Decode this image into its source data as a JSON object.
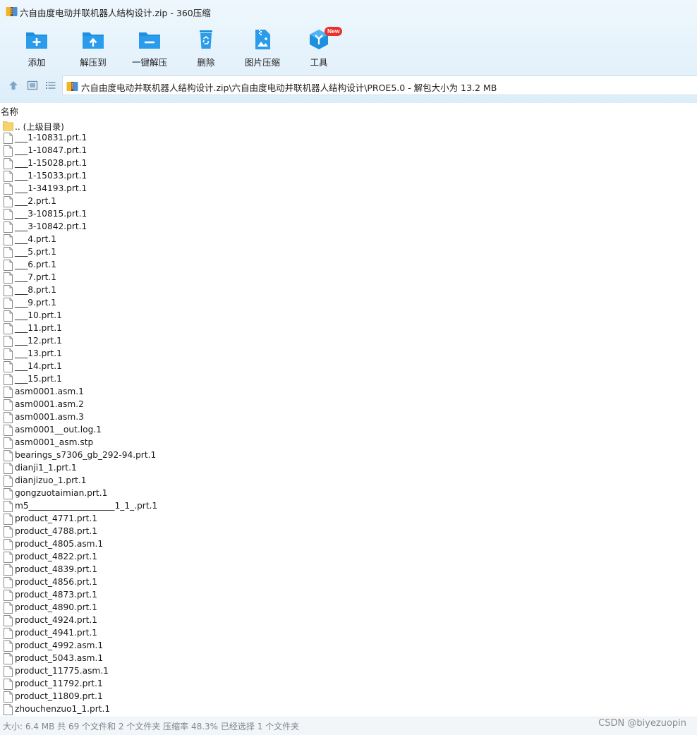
{
  "window": {
    "title": "六自由度电动并联机器人结构设计.zip - 360压缩"
  },
  "toolbar": {
    "add_label": "添加",
    "extract_to_label": "解压到",
    "one_click_extract_label": "一键解压",
    "delete_label": "删除",
    "image_compress_label": "图片压缩",
    "tools_label": "工具",
    "tools_badge": "New"
  },
  "address": {
    "path": "六自由度电动并联机器人结构设计.zip\\六自由度电动并联机器人结构设计\\PROE5.0 - 解包大小为 13.2 MB"
  },
  "list": {
    "column_name": "名称",
    "parent_label": ".. (上级目录)",
    "files": [
      "___1-10831.prt.1",
      "___1-10847.prt.1",
      "___1-15028.prt.1",
      "___1-15033.prt.1",
      "___1-34193.prt.1",
      "___2.prt.1",
      "___3-10815.prt.1",
      "___3-10842.prt.1",
      "___4.prt.1",
      "___5.prt.1",
      "___6.prt.1",
      "___7.prt.1",
      "___8.prt.1",
      "___9.prt.1",
      "___10.prt.1",
      "___11.prt.1",
      "___12.prt.1",
      "___13.prt.1",
      "___14.prt.1",
      "___15.prt.1",
      "asm0001.asm.1",
      "asm0001.asm.2",
      "asm0001.asm.3",
      "asm0001__out.log.1",
      "asm0001_asm.stp",
      "bearings_s7306_gb_292-94.prt.1",
      "dianji1_1.prt.1",
      "dianjizuo_1.prt.1",
      "gongzuotaimian.prt.1",
      "m5____________________1_1_.prt.1",
      "product_4771.prt.1",
      "product_4788.prt.1",
      "product_4805.asm.1",
      "product_4822.prt.1",
      "product_4839.prt.1",
      "product_4856.prt.1",
      "product_4873.prt.1",
      "product_4890.prt.1",
      "product_4924.prt.1",
      "product_4941.prt.1",
      "product_4992.asm.1",
      "product_5043.asm.1",
      "product_11775.asm.1",
      "product_11792.prt.1",
      "product_11809.prt.1",
      "zhouchenzuo1_1.prt.1"
    ]
  },
  "status": {
    "text": "大小: 6.4 MB 共 69 个文件和 2 个文件夹 压缩率 48.3% 已经选择 1 个文件夹",
    "watermark": "CSDN @biyezuopin"
  },
  "colors": {
    "toolbar_icon": "#1e90e0",
    "folder": "#f7d36a",
    "badge": "#e8322b"
  }
}
